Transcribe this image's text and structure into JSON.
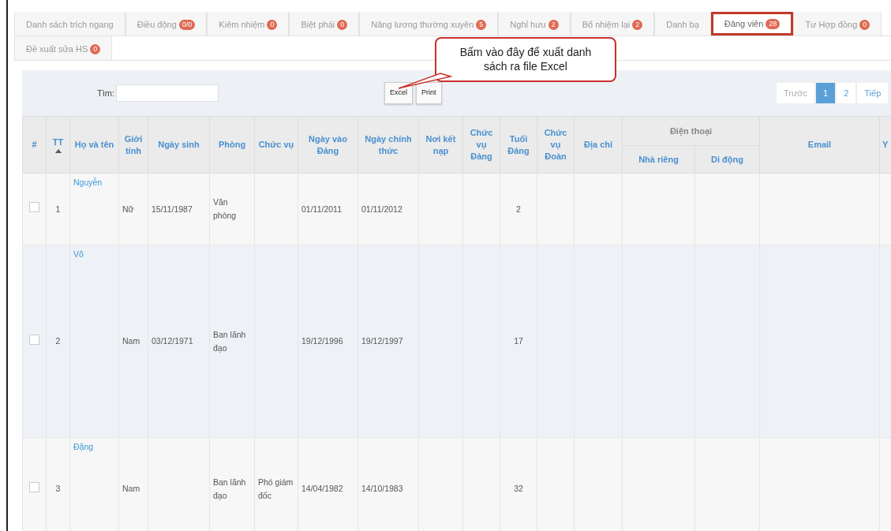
{
  "tab_rows": [
    [
      {
        "label": "Danh sách trích ngang",
        "selected": false,
        "highlighted": false
      },
      {
        "label": "Điều động",
        "badge": "0/0",
        "selected": false,
        "highlighted": false
      },
      {
        "label": "Kiêm nhiệm",
        "badge": "0",
        "selected": false,
        "highlighted": false
      },
      {
        "label": "Biệt phái",
        "badge": "0",
        "selected": false,
        "highlighted": false
      },
      {
        "label": "Nâng lương thường xuyên",
        "badge": "5",
        "selected": false,
        "highlighted": false
      },
      {
        "label": "Nghỉ hưu",
        "badge": "2",
        "selected": false,
        "highlighted": false
      },
      {
        "label": "Bổ nhiệm lại",
        "badge": "2",
        "selected": false,
        "highlighted": false
      },
      {
        "label": "Danh bạ",
        "selected": false,
        "highlighted": false
      },
      {
        "label": "Đảng viên",
        "badge": "28",
        "selected": true,
        "highlighted": true
      },
      {
        "label": "Tư Hợp đồng",
        "badge": "0",
        "selected": false,
        "highlighted": false
      }
    ],
    [
      {
        "label": "Đề xuất sửa HS",
        "badge": "0",
        "selected": false,
        "highlighted": false
      }
    ]
  ],
  "callout": {
    "text": "Bấm vào đây để xuất danh sách ra file Excel"
  },
  "toolbar": {
    "search_label": "Tìm:",
    "buttons": [
      "Excel",
      "Print"
    ],
    "pagination": [
      {
        "label": "Trước",
        "selected": false,
        "disabled": true
      },
      {
        "label": "1",
        "selected": true,
        "disabled": false
      },
      {
        "label": "2",
        "selected": false,
        "disabled": false
      },
      {
        "label": "Tiếp",
        "selected": false,
        "disabled": false
      }
    ]
  },
  "table": {
    "columns": [
      {
        "label": "#",
        "kind": "text"
      },
      {
        "label": "TT",
        "kind": "text",
        "sorted": true
      },
      {
        "label": "Họ và tên",
        "kind": "link"
      },
      {
        "label": "Giới tính",
        "kind": "text"
      },
      {
        "label": "Ngày sinh",
        "kind": "text"
      },
      {
        "label": "Phòng",
        "kind": "text"
      },
      {
        "label": "Chức vụ",
        "kind": "text"
      },
      {
        "label": "Ngày vào Đảng",
        "kind": "text"
      },
      {
        "label": "Ngày chính thức",
        "kind": "text"
      },
      {
        "label": "Nơi kết nạp",
        "kind": "text"
      },
      {
        "label": "Chức vụ Đảng",
        "kind": "text"
      },
      {
        "label": "Tuổi Đảng",
        "kind": "text"
      },
      {
        "label": "Chức vụ Đoàn",
        "kind": "text"
      },
      {
        "label": "Địa chỉ",
        "kind": "text"
      },
      {
        "label": "Điện thoại",
        "kind": "group",
        "children": [
          {
            "label": "Nhà riêng"
          },
          {
            "label": "Di động"
          }
        ]
      },
      {
        "label": "Email",
        "kind": "text"
      },
      {
        "label": "Y",
        "kind": "text"
      }
    ],
    "rows": [
      {
        "cells": [
          {
            "kind": "checkbox",
            "checked": false
          },
          "1",
          "Nguyễn",
          "Nữ",
          "15/11/1987",
          "Văn phòng",
          null,
          "01/11/2011",
          "01/11/2012",
          null,
          null,
          "2",
          null,
          null,
          null,
          null,
          null,
          null
        ]
      },
      {
        "cells": [
          {
            "kind": "checkbox",
            "checked": false
          },
          "2",
          "Võ",
          "Nam",
          "03/12/1971",
          "Ban lãnh đạo",
          null,
          "19/12/1996",
          "19/12/1997",
          null,
          null,
          "17",
          null,
          null,
          null,
          null,
          null,
          null
        ]
      },
      {
        "cells": [
          {
            "kind": "checkbox",
            "checked": false
          },
          "3",
          "Đặng",
          "Nam",
          null,
          "Ban lãnh đạo",
          "Phó giám đốc",
          "14/04/1982",
          "14/10/1983",
          null,
          null,
          "32",
          null,
          null,
          null,
          null,
          null,
          null
        ]
      }
    ]
  }
}
